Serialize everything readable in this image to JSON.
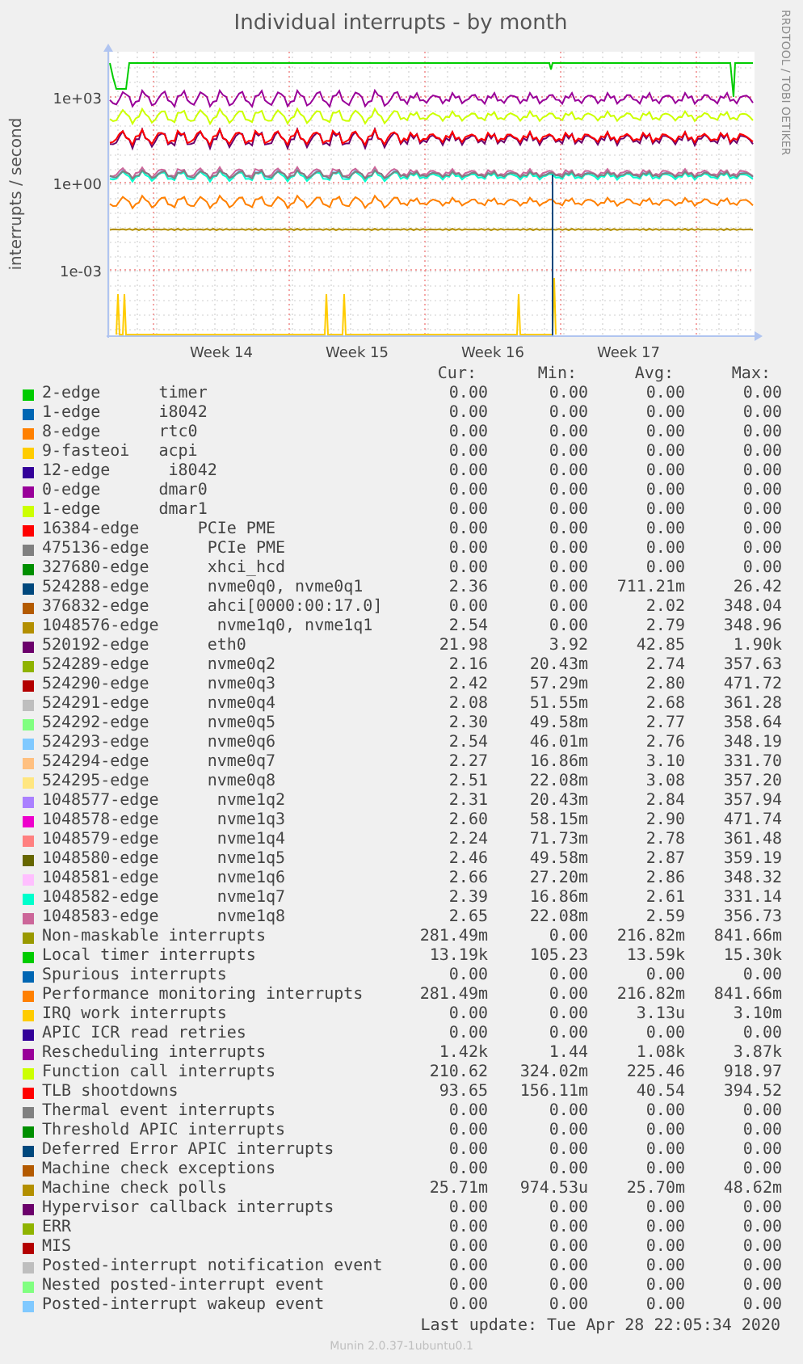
{
  "graph": {
    "title": "Individual interrupts - by month",
    "ylabel": "interrupts / second",
    "side_text": "RRDTOOL / TOBI OETIKER",
    "yticks": [
      "1e+03",
      "1e+00",
      "1e-03"
    ],
    "xticks": [
      "Week 14",
      "Week 15",
      "Week 16",
      "Week 17"
    ]
  },
  "legend": {
    "headers": [
      "Cur:",
      "Min:",
      "Avg:",
      "Max:"
    ],
    "rows": [
      {
        "color": "#00cc00",
        "name": "2-edge      timer",
        "cur": "0.00",
        "min": "0.00",
        "avg": "0.00",
        "max": "0.00"
      },
      {
        "color": "#0066b3",
        "name": "1-edge      i8042",
        "cur": "0.00",
        "min": "0.00",
        "avg": "0.00",
        "max": "0.00"
      },
      {
        "color": "#ff8000",
        "name": "8-edge      rtc0",
        "cur": "0.00",
        "min": "0.00",
        "avg": "0.00",
        "max": "0.00"
      },
      {
        "color": "#ffcc00",
        "name": "9-fasteoi   acpi",
        "cur": "0.00",
        "min": "0.00",
        "avg": "0.00",
        "max": "0.00"
      },
      {
        "color": "#330099",
        "name": "12-edge      i8042",
        "cur": "0.00",
        "min": "0.00",
        "avg": "0.00",
        "max": "0.00"
      },
      {
        "color": "#990099",
        "name": "0-edge      dmar0",
        "cur": "0.00",
        "min": "0.00",
        "avg": "0.00",
        "max": "0.00"
      },
      {
        "color": "#ccff00",
        "name": "1-edge      dmar1",
        "cur": "0.00",
        "min": "0.00",
        "avg": "0.00",
        "max": "0.00"
      },
      {
        "color": "#ff0000",
        "name": "16384-edge      PCIe PME",
        "cur": "0.00",
        "min": "0.00",
        "avg": "0.00",
        "max": "0.00"
      },
      {
        "color": "#808080",
        "name": "475136-edge      PCIe PME",
        "cur": "0.00",
        "min": "0.00",
        "avg": "0.00",
        "max": "0.00"
      },
      {
        "color": "#008f00",
        "name": "327680-edge      xhci_hcd",
        "cur": "0.00",
        "min": "0.00",
        "avg": "0.00",
        "max": "0.00"
      },
      {
        "color": "#00487d",
        "name": "524288-edge      nvme0q0, nvme0q1",
        "cur": "2.36",
        "min": "0.00",
        "avg": "711.21m",
        "max": "26.42"
      },
      {
        "color": "#b35a00",
        "name": "376832-edge      ahci[0000:00:17.0]",
        "cur": "0.00",
        "min": "0.00",
        "avg": "2.02",
        "max": "348.04"
      },
      {
        "color": "#b38f00",
        "name": "1048576-edge      nvme1q0, nvme1q1",
        "cur": "2.54",
        "min": "0.00",
        "avg": "2.79",
        "max": "348.96"
      },
      {
        "color": "#6b006b",
        "name": "520192-edge      eth0",
        "cur": "21.98",
        "min": "3.92",
        "avg": "42.85",
        "max": "1.90k"
      },
      {
        "color": "#8fb300",
        "name": "524289-edge      nvme0q2",
        "cur": "2.16",
        "min": "20.43m",
        "avg": "2.74",
        "max": "357.63"
      },
      {
        "color": "#b30000",
        "name": "524290-edge      nvme0q3",
        "cur": "2.42",
        "min": "57.29m",
        "avg": "2.80",
        "max": "471.72"
      },
      {
        "color": "#bebebe",
        "name": "524291-edge      nvme0q4",
        "cur": "2.08",
        "min": "51.55m",
        "avg": "2.68",
        "max": "361.28"
      },
      {
        "color": "#80ff80",
        "name": "524292-edge      nvme0q5",
        "cur": "2.30",
        "min": "49.58m",
        "avg": "2.77",
        "max": "358.64"
      },
      {
        "color": "#80c9ff",
        "name": "524293-edge      nvme0q6",
        "cur": "2.54",
        "min": "46.01m",
        "avg": "2.76",
        "max": "348.19"
      },
      {
        "color": "#ffc080",
        "name": "524294-edge      nvme0q7",
        "cur": "2.27",
        "min": "16.86m",
        "avg": "3.10",
        "max": "331.70"
      },
      {
        "color": "#ffe680",
        "name": "524295-edge      nvme0q8",
        "cur": "2.51",
        "min": "22.08m",
        "avg": "3.08",
        "max": "357.20"
      },
      {
        "color": "#aa80ff",
        "name": "1048577-edge      nvme1q2",
        "cur": "2.31",
        "min": "20.43m",
        "avg": "2.84",
        "max": "357.94"
      },
      {
        "color": "#ee00cc",
        "name": "1048578-edge      nvme1q3",
        "cur": "2.60",
        "min": "58.15m",
        "avg": "2.90",
        "max": "471.74"
      },
      {
        "color": "#ff8080",
        "name": "1048579-edge      nvme1q4",
        "cur": "2.24",
        "min": "71.73m",
        "avg": "2.78",
        "max": "361.48"
      },
      {
        "color": "#666600",
        "name": "1048580-edge      nvme1q5",
        "cur": "2.46",
        "min": "49.58m",
        "avg": "2.87",
        "max": "359.19"
      },
      {
        "color": "#ffbfff",
        "name": "1048581-edge      nvme1q6",
        "cur": "2.66",
        "min": "27.20m",
        "avg": "2.86",
        "max": "348.32"
      },
      {
        "color": "#00ffcc",
        "name": "1048582-edge      nvme1q7",
        "cur": "2.39",
        "min": "16.86m",
        "avg": "2.61",
        "max": "331.14"
      },
      {
        "color": "#cc6699",
        "name": "1048583-edge      nvme1q8",
        "cur": "2.65",
        "min": "22.08m",
        "avg": "2.59",
        "max": "356.73"
      },
      {
        "color": "#999900",
        "name": "Non-maskable interrupts",
        "cur": "281.49m",
        "min": "0.00",
        "avg": "216.82m",
        "max": "841.66m"
      },
      {
        "color": "#00cc00",
        "name": "Local timer interrupts",
        "cur": "13.19k",
        "min": "105.23",
        "avg": "13.59k",
        "max": "15.30k"
      },
      {
        "color": "#0066b3",
        "name": "Spurious interrupts",
        "cur": "0.00",
        "min": "0.00",
        "avg": "0.00",
        "max": "0.00"
      },
      {
        "color": "#ff8000",
        "name": "Performance monitoring interrupts",
        "cur": "281.49m",
        "min": "0.00",
        "avg": "216.82m",
        "max": "841.66m"
      },
      {
        "color": "#ffcc00",
        "name": "IRQ work interrupts",
        "cur": "0.00",
        "min": "0.00",
        "avg": "3.13u",
        "max": "3.10m"
      },
      {
        "color": "#330099",
        "name": "APIC ICR read retries",
        "cur": "0.00",
        "min": "0.00",
        "avg": "0.00",
        "max": "0.00"
      },
      {
        "color": "#990099",
        "name": "Rescheduling interrupts",
        "cur": "1.42k",
        "min": "1.44",
        "avg": "1.08k",
        "max": "3.87k"
      },
      {
        "color": "#ccff00",
        "name": "Function call interrupts",
        "cur": "210.62",
        "min": "324.02m",
        "avg": "225.46",
        "max": "918.97"
      },
      {
        "color": "#ff0000",
        "name": "TLB shootdowns",
        "cur": "93.65",
        "min": "156.11m",
        "avg": "40.54",
        "max": "394.52"
      },
      {
        "color": "#808080",
        "name": "Thermal event interrupts",
        "cur": "0.00",
        "min": "0.00",
        "avg": "0.00",
        "max": "0.00"
      },
      {
        "color": "#008f00",
        "name": "Threshold APIC interrupts",
        "cur": "0.00",
        "min": "0.00",
        "avg": "0.00",
        "max": "0.00"
      },
      {
        "color": "#00487d",
        "name": "Deferred Error APIC interrupts",
        "cur": "0.00",
        "min": "0.00",
        "avg": "0.00",
        "max": "0.00"
      },
      {
        "color": "#b35a00",
        "name": "Machine check exceptions",
        "cur": "0.00",
        "min": "0.00",
        "avg": "0.00",
        "max": "0.00"
      },
      {
        "color": "#b38f00",
        "name": "Machine check polls",
        "cur": "25.71m",
        "min": "974.53u",
        "avg": "25.70m",
        "max": "48.62m"
      },
      {
        "color": "#6b006b",
        "name": "Hypervisor callback interrupts",
        "cur": "0.00",
        "min": "0.00",
        "avg": "0.00",
        "max": "0.00"
      },
      {
        "color": "#8fb300",
        "name": "ERR",
        "cur": "0.00",
        "min": "0.00",
        "avg": "0.00",
        "max": "0.00"
      },
      {
        "color": "#b30000",
        "name": "MIS",
        "cur": "0.00",
        "min": "0.00",
        "avg": "0.00",
        "max": "0.00"
      },
      {
        "color": "#bebebe",
        "name": "Posted-interrupt notification event",
        "cur": "0.00",
        "min": "0.00",
        "avg": "0.00",
        "max": "0.00"
      },
      {
        "color": "#80ff80",
        "name": "Nested posted-interrupt event",
        "cur": "0.00",
        "min": "0.00",
        "avg": "0.00",
        "max": "0.00"
      },
      {
        "color": "#80c9ff",
        "name": "Posted-interrupt wakeup event",
        "cur": "0.00",
        "min": "0.00",
        "avg": "0.00",
        "max": "0.00"
      }
    ]
  },
  "last_update": "Last update: Tue Apr 28 22:05:34 2020",
  "footer": "Munin 2.0.37-1ubuntu0.1"
}
